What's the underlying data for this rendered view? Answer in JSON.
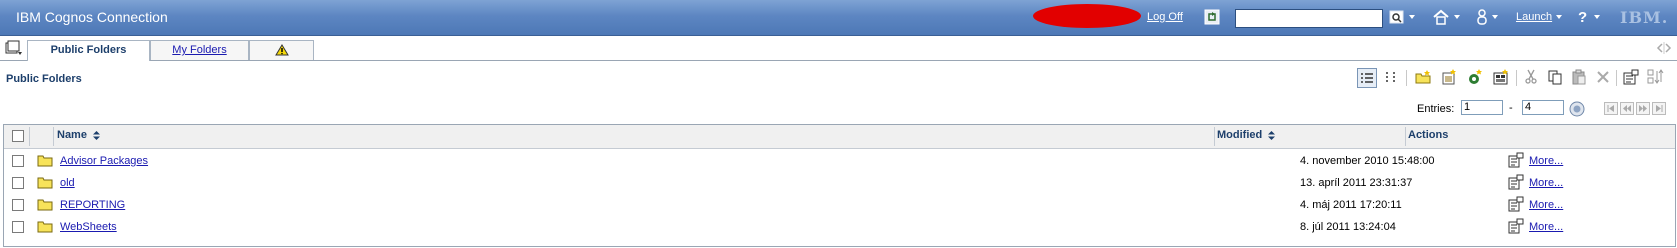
{
  "banner": {
    "app_title": "IBM Cognos Connection",
    "logoff_label": "Log Off",
    "search_value": "",
    "launch_label": "Launch",
    "ibm_logo": "IBM.",
    "icons": [
      "refresh-icon",
      "search-options-icon",
      "home-icon",
      "user-icon",
      "help-icon"
    ]
  },
  "tabs": [
    {
      "label": "Public Folders",
      "active": true
    },
    {
      "label": "My Folders",
      "active": false
    },
    {
      "label": "",
      "icon": "warning-icon",
      "active": false
    }
  ],
  "folder": {
    "title": "Public Folders",
    "toolbar_icons": [
      "details-view-icon",
      "list-view-icon",
      "new-folder-icon",
      "new-package-icon",
      "new-job-icon",
      "new-agent-icon",
      "cut-icon",
      "copy-icon",
      "paste-icon",
      "delete-icon",
      "set-properties-icon",
      "order-icon"
    ]
  },
  "pagination": {
    "entries_label": "Entries:",
    "from": "1",
    "separator": "-",
    "to": "4"
  },
  "table": {
    "columns": {
      "name": "Name",
      "modified": "Modified",
      "actions": "Actions"
    },
    "rows": [
      {
        "name": "Advisor Packages",
        "modified": "4. november 2010 15:48:00",
        "action": "More..."
      },
      {
        "name": "old",
        "modified": "13. apríl 2011 23:31:37",
        "action": "More..."
      },
      {
        "name": "REPORTING",
        "modified": "4. máj 2011 17:20:11",
        "action": "More..."
      },
      {
        "name": "WebSheets",
        "modified": "8. júl 2011 13:24:04",
        "action": "More..."
      }
    ]
  },
  "colors": {
    "banner": "#5d86c2",
    "link": "#1a1ab0",
    "header_text": "#1d3f6b",
    "folder_icon": "#f7e35a",
    "redaction": "#e20000"
  }
}
